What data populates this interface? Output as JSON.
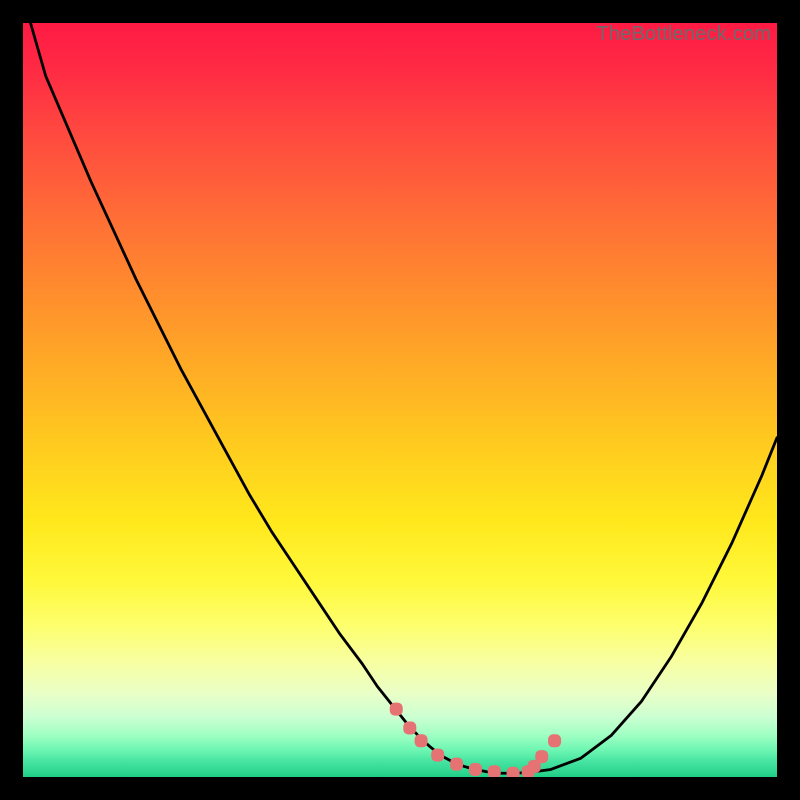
{
  "watermark": "TheBottleneck.com",
  "colors": {
    "frame": "#000000",
    "curve": "#000000",
    "marker": "#e57373",
    "watermark": "#6b6b6b"
  },
  "chart_data": {
    "type": "line",
    "title": "",
    "xlabel": "",
    "ylabel": "",
    "xlim": [
      0,
      100
    ],
    "ylim": [
      0,
      100
    ],
    "x": [
      0,
      1,
      3,
      6,
      9,
      12,
      15,
      18,
      21,
      24,
      27,
      30,
      33,
      36,
      39,
      42,
      45,
      47,
      49,
      51,
      52.5,
      54,
      55.5,
      57,
      58.5,
      60,
      61.5,
      63,
      65,
      67,
      70,
      74,
      78,
      82,
      86,
      90,
      94,
      98,
      100
    ],
    "values": [
      110,
      100,
      93,
      86,
      79,
      72.5,
      66,
      60,
      54,
      48.5,
      43,
      37.5,
      32.5,
      28,
      23.5,
      19,
      15,
      12,
      9.5,
      7,
      5.4,
      4,
      2.8,
      2,
      1.4,
      1,
      0.7,
      0.5,
      0.5,
      0.6,
      1,
      2.5,
      5.5,
      10,
      16,
      23,
      31,
      40,
      45
    ],
    "markers": {
      "x": [
        49.5,
        51.3,
        52.8,
        55,
        57.5,
        60,
        62.5,
        65,
        67,
        67.8,
        68.8,
        70.5
      ],
      "y": [
        9.0,
        6.5,
        4.8,
        2.9,
        1.7,
        1.0,
        0.7,
        0.5,
        0.7,
        1.4,
        2.7,
        4.8
      ]
    },
    "annotations": []
  }
}
